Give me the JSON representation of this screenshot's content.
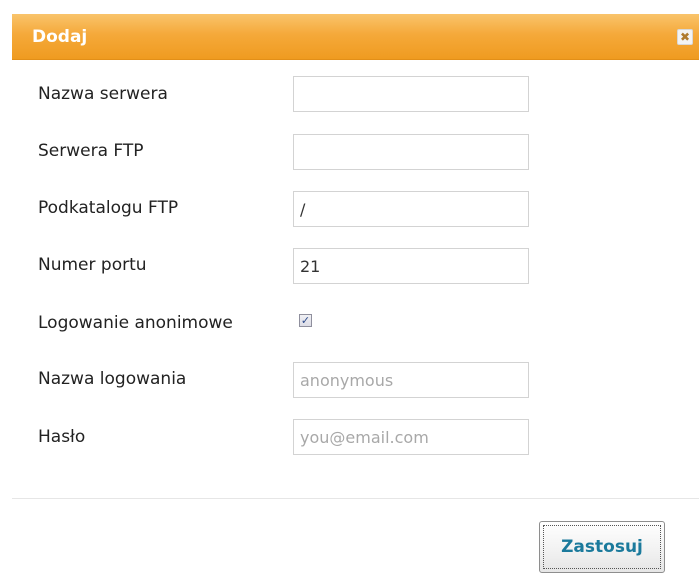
{
  "dialog": {
    "title": "Dodaj",
    "close_symbol": "✖"
  },
  "form": {
    "fields": [
      {
        "label": "Nazwa serwera",
        "value": ""
      },
      {
        "label": "Serwera FTP",
        "value": ""
      },
      {
        "label": "Podkatalogu FTP",
        "value": "/"
      },
      {
        "label": "Numer portu",
        "value": "21"
      }
    ],
    "anonymous": {
      "label": "Logowanie anonimowe",
      "checked": true,
      "check_glyph": "✓"
    },
    "login": {
      "label": "Nazwa logowania",
      "value": "anonymous"
    },
    "password": {
      "label": "Hasło",
      "value": "you@email.com"
    }
  },
  "footer": {
    "apply_label": "Zastosuj"
  },
  "colors": {
    "title_bar": "#f5a93a",
    "title_text": "#ffffff",
    "apply_text": "#1b7a9c",
    "muted_input_text": "#a8a8a8"
  },
  "icons": {
    "close": "close-icon",
    "checkbox": "checkmark-icon"
  }
}
